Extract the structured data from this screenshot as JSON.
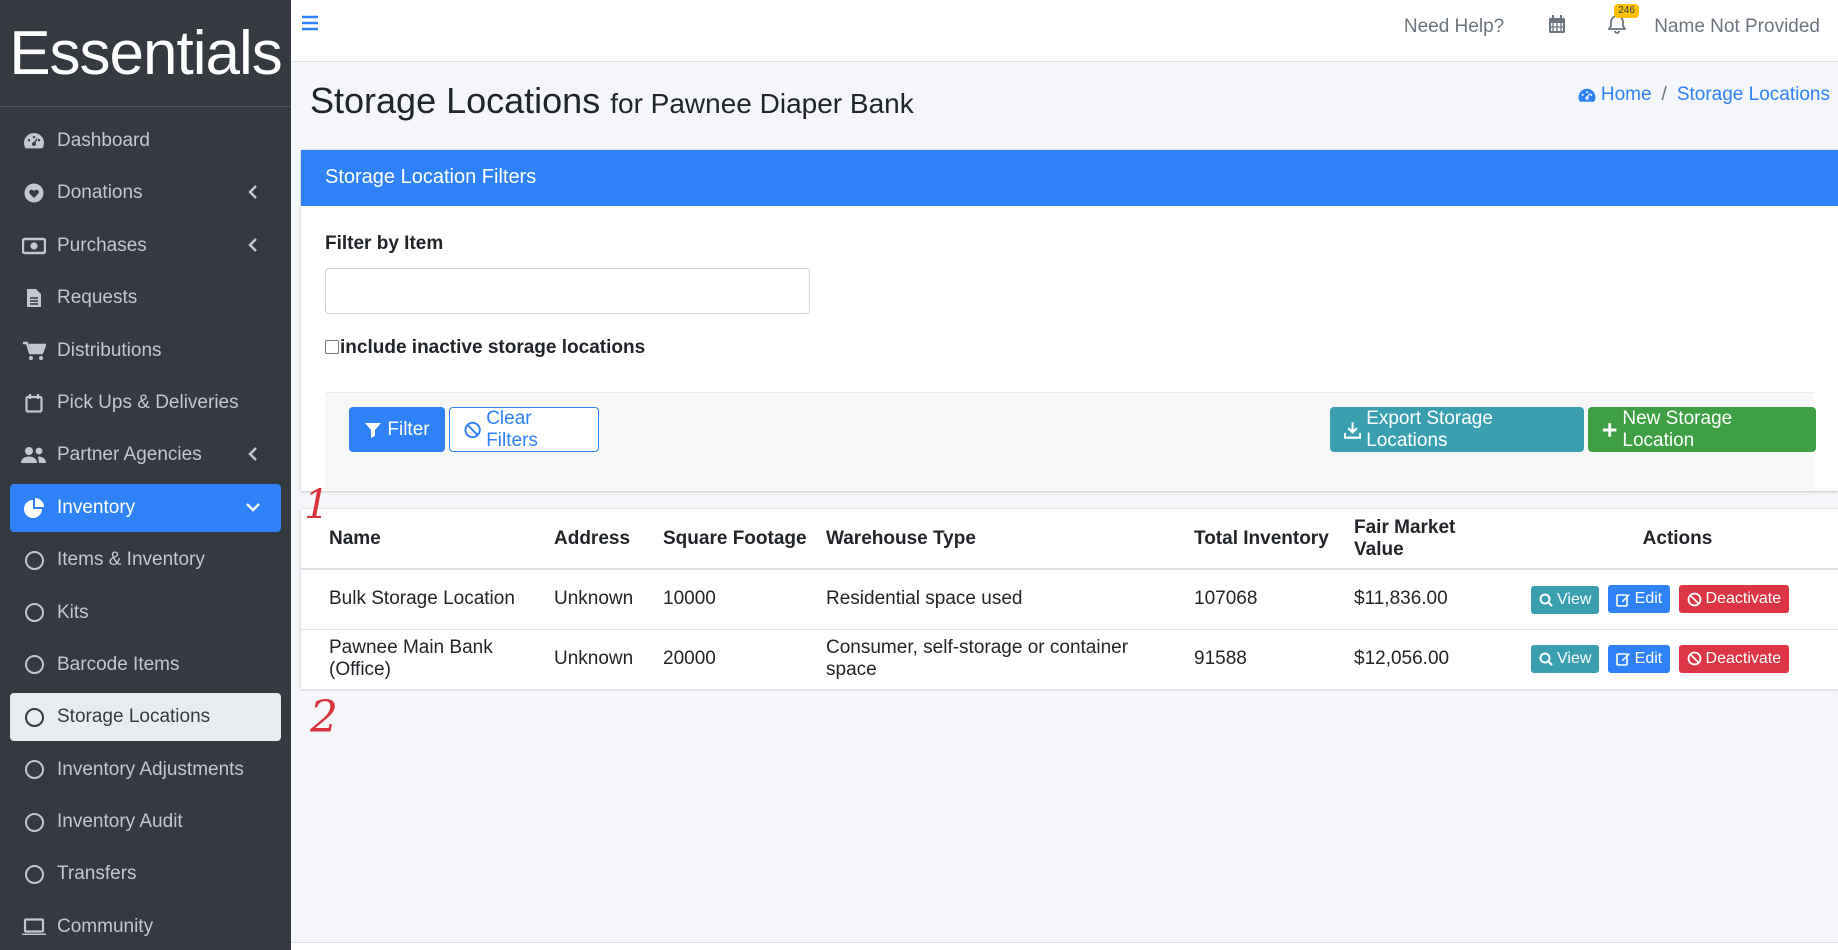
{
  "brand": "Essentials",
  "sidebar": {
    "items": [
      {
        "label": "Dashboard",
        "icon": "dashboard-icon"
      },
      {
        "label": "Donations",
        "icon": "heart-icon",
        "chevron": "left"
      },
      {
        "label": "Purchases",
        "icon": "money-icon",
        "chevron": "left"
      },
      {
        "label": "Requests",
        "icon": "file-icon"
      },
      {
        "label": "Distributions",
        "icon": "cart-icon"
      },
      {
        "label": "Pick Ups & Deliveries",
        "icon": "calendar-icon"
      },
      {
        "label": "Partner Agencies",
        "icon": "users-icon",
        "chevron": "left"
      },
      {
        "label": "Inventory",
        "icon": "pie-icon",
        "chevron": "down",
        "active": true
      },
      {
        "label": "Items & Inventory",
        "icon": "circle-icon"
      },
      {
        "label": "Kits",
        "icon": "circle-icon"
      },
      {
        "label": "Barcode Items",
        "icon": "circle-icon"
      },
      {
        "label": "Storage Locations",
        "icon": "circle-icon",
        "current": true
      },
      {
        "label": "Inventory Adjustments",
        "icon": "circle-icon"
      },
      {
        "label": "Inventory Audit",
        "icon": "circle-icon"
      },
      {
        "label": "Transfers",
        "icon": "circle-icon"
      },
      {
        "label": "Community",
        "icon": "laptop-icon"
      }
    ]
  },
  "topbar": {
    "help": "Need Help?",
    "notifications_count": "246",
    "user": "Name Not Provided"
  },
  "page": {
    "title": "Storage Locations",
    "subtitle": "for Pawnee Diaper Bank",
    "breadcrumb": [
      "Home",
      "Storage Locations"
    ]
  },
  "filters": {
    "header": "Storage Location Filters",
    "filter_by_item_label": "Filter by Item",
    "filter_by_item_value": "",
    "include_inactive_label": "include inactive storage locations",
    "filter_button": "Filter",
    "clear_button": "Clear Filters",
    "export_button": "Export Storage Locations",
    "new_button": "New Storage Location"
  },
  "table": {
    "headers": [
      "Name",
      "Address",
      "Square Footage",
      "Warehouse Type",
      "Total Inventory",
      "Fair Market Value",
      "Actions"
    ],
    "rows": [
      [
        "Bulk Storage Location",
        "Unknown",
        "10000",
        "Residential space used",
        "107068",
        "$11,836.00"
      ],
      [
        "Pawnee Main Bank (Office)",
        "Unknown",
        "20000",
        "Consumer, self-storage or container space",
        "91588",
        "$12,056.00"
      ]
    ],
    "actions": {
      "view": "View",
      "edit": "Edit",
      "deactivate": "Deactivate"
    }
  },
  "annotations": [
    "1",
    "2"
  ],
  "colors": {
    "primary": "#2f81f7",
    "sidebar": "#343a40",
    "info": "#3aa0b0",
    "success": "#3f9f44",
    "danger": "#dc3545"
  }
}
